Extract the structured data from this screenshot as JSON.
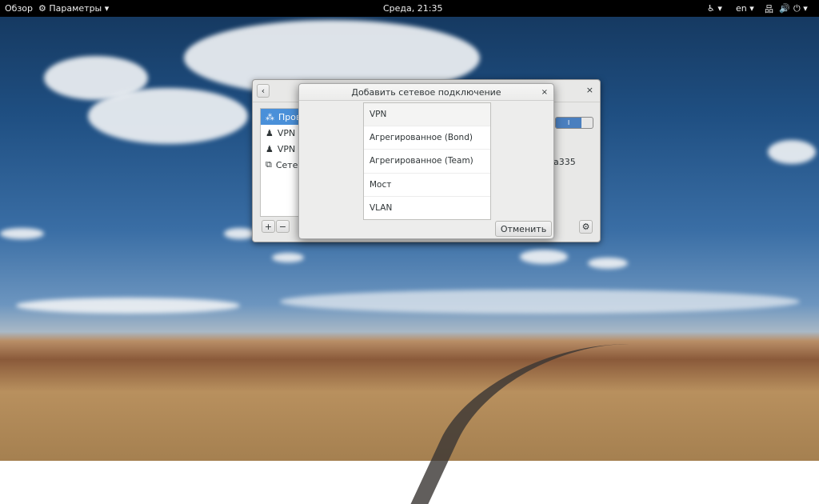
{
  "topbar": {
    "overview": "Обзор",
    "app_menu": "Параметры",
    "clock": "Среда, 21:35",
    "language": "en"
  },
  "window": {
    "sidebar": [
      {
        "label": "Пров",
        "icon": "wired-network-icon"
      },
      {
        "label": "VPN F",
        "icon": "vpn-icon"
      },
      {
        "label": "VPN z",
        "icon": "vpn-icon"
      },
      {
        "label": "Сете",
        "icon": "network-proxy-icon"
      }
    ],
    "partial_text": "a335",
    "add": "+",
    "remove": "−"
  },
  "dialog": {
    "title": "Добавить сетевое подключение",
    "options": [
      "VPN",
      "Агрегированное (Bond)",
      "Агрегированное (Team)",
      "Мост",
      "VLAN"
    ],
    "cancel": "Отменить"
  }
}
